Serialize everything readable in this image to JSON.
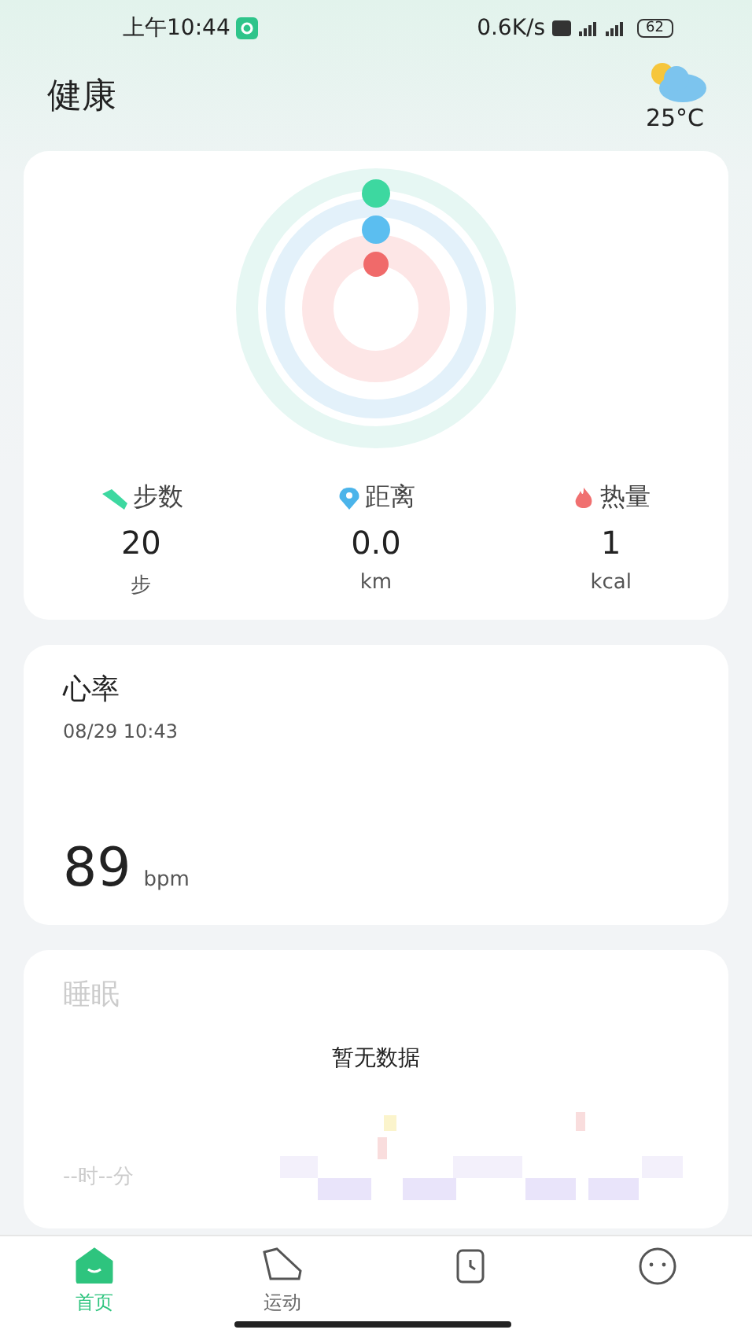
{
  "status_bar": {
    "time": "上午10:44",
    "network_speed": "0.6K/s",
    "battery": "62"
  },
  "header": {
    "title": "健康",
    "temperature": "25°C"
  },
  "activity": {
    "metrics": [
      {
        "kind": "steps",
        "label": "步数",
        "value": "20",
        "unit": "步"
      },
      {
        "kind": "distance",
        "label": "距离",
        "value": "0.0",
        "unit": "km"
      },
      {
        "kind": "calories",
        "label": "热量",
        "value": "1",
        "unit": "kcal"
      }
    ]
  },
  "heart_rate": {
    "title": "心率",
    "timestamp": "08/29 10:43",
    "value": "89",
    "unit": "bpm"
  },
  "sleep": {
    "title": "睡眠",
    "empty_message": "暂无数据",
    "duration": "--时--分",
    "disabled": true
  },
  "tabs": [
    {
      "kind": "home",
      "label": "首页",
      "selected": true
    },
    {
      "kind": "sport",
      "label": "运动",
      "selected": false
    },
    {
      "kind": "device",
      "selected": false
    },
    {
      "kind": "profile",
      "selected": false
    }
  ]
}
